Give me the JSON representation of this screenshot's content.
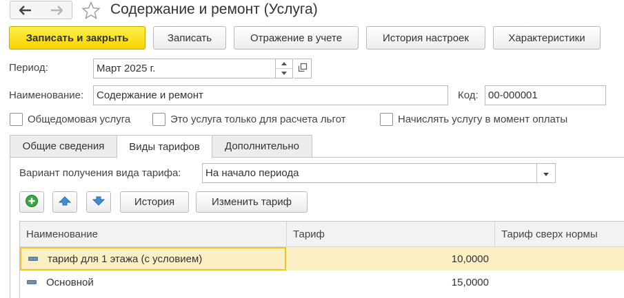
{
  "window": {
    "title": "Содержание и ремонт (Услуга)"
  },
  "toolbar": {
    "save_close_label": "Записать и закрыть",
    "save_label": "Записать",
    "accounting_label": "Отражение в учете",
    "history_settings_label": "История настроек",
    "characteristics_label": "Характеристики"
  },
  "form": {
    "period_label": "Период:",
    "period_value": "Март 2025 г.",
    "name_label": "Наименование:",
    "name_value": "Содержание и ремонт",
    "code_label": "Код:",
    "code_value": "00-000001"
  },
  "checkboxes": [
    {
      "label": "Общедомовая услуга",
      "checked": false
    },
    {
      "label": "Это услуга только для расчета льгот",
      "checked": false
    },
    {
      "label": "Начислять услугу в момент оплаты",
      "checked": false
    }
  ],
  "tabs": [
    {
      "label": "Общие сведения",
      "active": false
    },
    {
      "label": "Виды тарифов",
      "active": true
    },
    {
      "label": "Дополнительно",
      "active": false
    }
  ],
  "tariff_panel": {
    "variant_label": "Вариант получения вида тарифа:",
    "variant_value": "На начало периода",
    "history_button": "История",
    "change_tariff_button": "Изменить тариф"
  },
  "table": {
    "columns": [
      "Наименование",
      "Тариф",
      "Тариф сверх нормы"
    ],
    "rows": [
      {
        "name": "тариф для 1 этажа (с условием)",
        "tariff": "10,0000",
        "over_norm": "",
        "selected": true
      },
      {
        "name": "Основной",
        "tariff": "15,0000",
        "over_norm": "",
        "selected": false
      }
    ]
  },
  "icons": {
    "back": "arrow-left-icon",
    "forward": "arrow-right-icon",
    "favorite": "star-icon",
    "add": "plus-circle-icon",
    "up": "arrow-up-icon",
    "down": "arrow-down-icon",
    "row": "dash-icon"
  },
  "colors": {
    "primary_button": "#f5d400",
    "selected_row": "#fbf0c4",
    "selected_border": "#f2c12e",
    "add_icon": "#3aa640",
    "arrow_icon": "#3f8fd8"
  }
}
